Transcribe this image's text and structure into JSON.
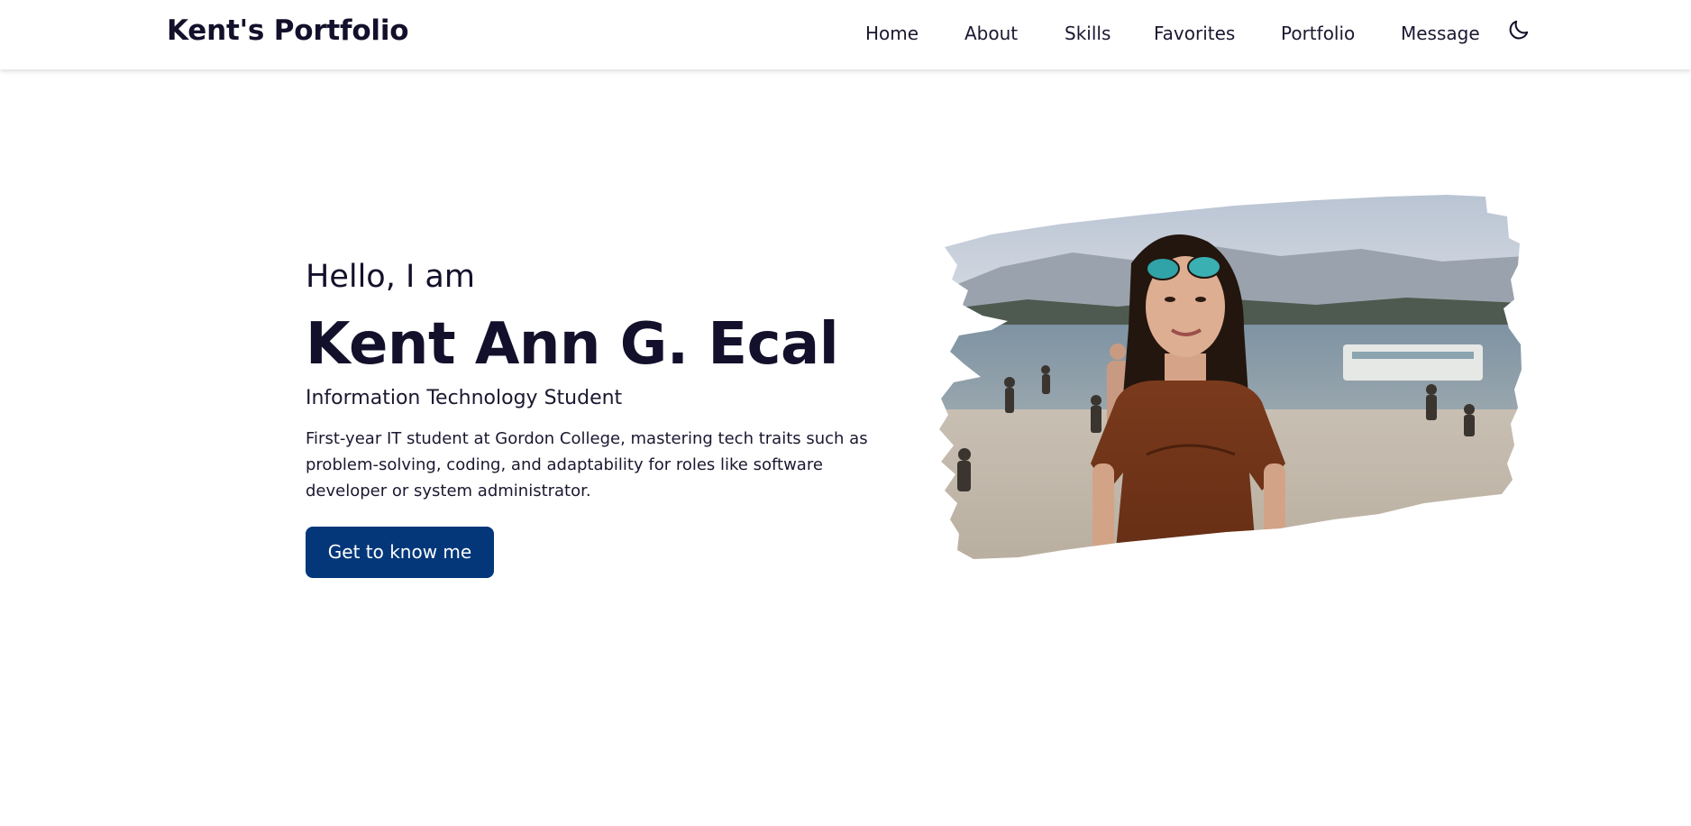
{
  "header": {
    "brand": "Kent's Portfolio",
    "nav": [
      {
        "label": "Home"
      },
      {
        "label": "About"
      },
      {
        "label": "Skills"
      },
      {
        "label": "Favorites"
      },
      {
        "label": "Portfolio"
      },
      {
        "label": "Message"
      }
    ],
    "theme_toggle_icon": "moon-icon"
  },
  "hero": {
    "greeting": "Hello, I am",
    "name": "Kent Ann G. Ecal",
    "role": "Information Technology Student",
    "description": "First-year IT student at Gordon College, mastering tech traits such as problem-solving, coding, and adaptability for roles like software developer or system administrator.",
    "cta_label": "Get to know me",
    "photo_icon": "profile-photo"
  },
  "colors": {
    "text": "#13102b",
    "accent": "#04377a",
    "background": "#ffffff"
  }
}
